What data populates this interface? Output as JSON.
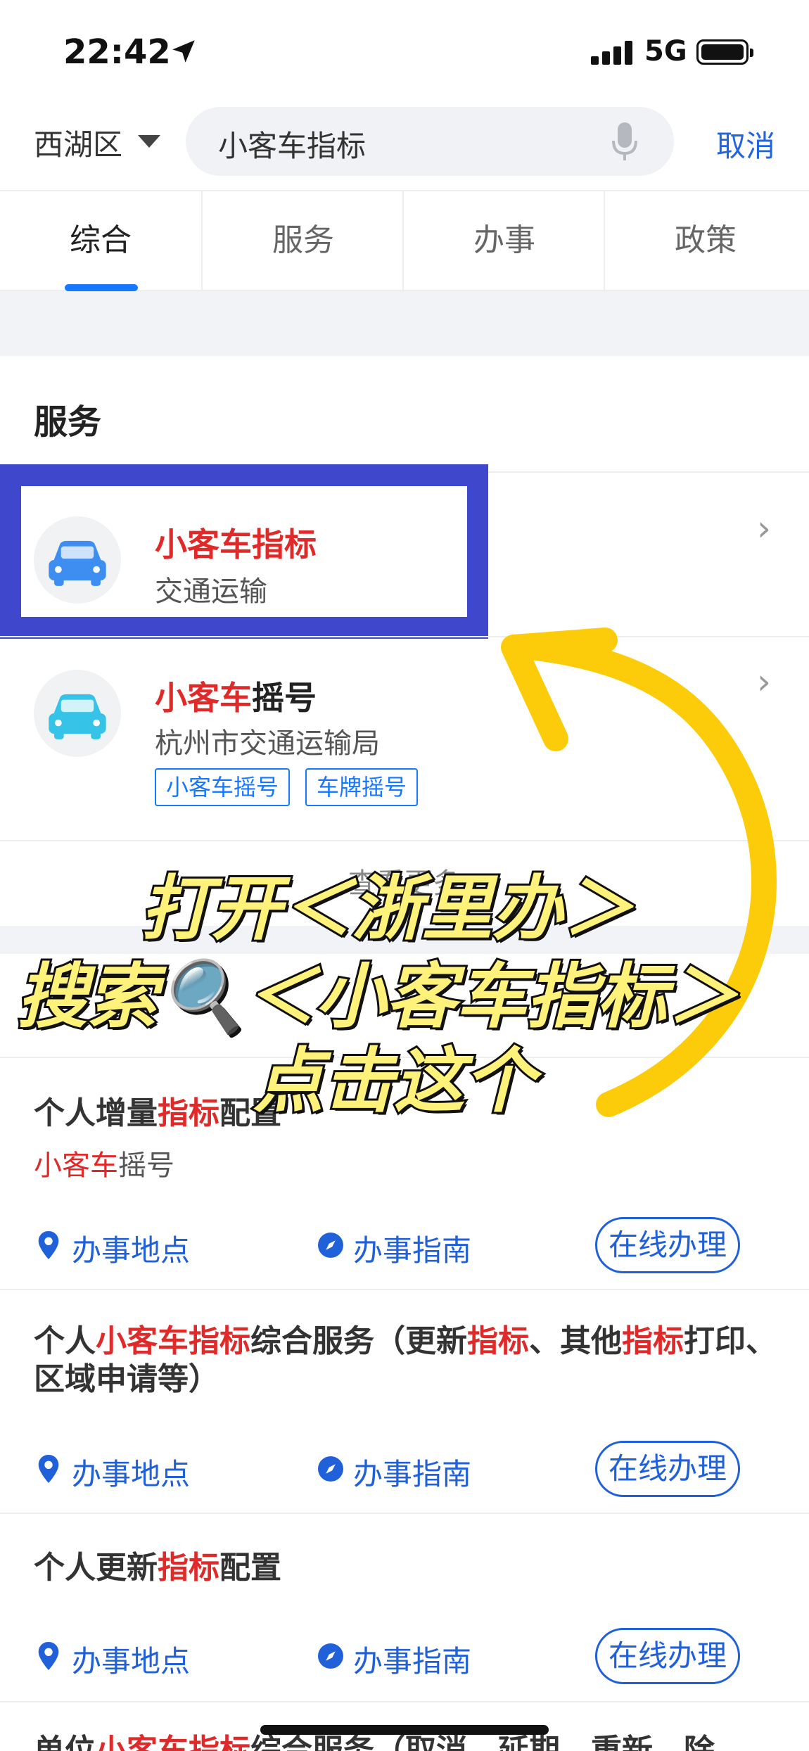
{
  "status_bar": {
    "time": "22:42",
    "network": "5G"
  },
  "search": {
    "district": "西湖区",
    "query": "小客车指标",
    "cancel": "取消"
  },
  "tabs": [
    {
      "label": "综合"
    },
    {
      "label": "服务"
    },
    {
      "label": "办事"
    },
    {
      "label": "政策"
    }
  ],
  "services": {
    "title": "服务",
    "items": [
      {
        "title_highlight": "小客车指标",
        "title_rest": "",
        "subtitle": "交通运输",
        "icon": "car-icon",
        "icon_color": "#3d8ef0",
        "tags": []
      },
      {
        "title_highlight": "小客车",
        "title_rest": "摇号",
        "subtitle": "杭州市交通运输局",
        "icon": "car-icon",
        "icon_color": "#35c3e8",
        "tags": [
          "小客车摇号",
          "车牌摇号"
        ]
      }
    ],
    "more_partial": "查看更多"
  },
  "overlay": {
    "line1": "打开＜浙里办＞",
    "line2": "搜索🔍＜小客车指标＞",
    "line3": "点击这个",
    "highlight_color": "#3f48cc",
    "arrow_color": "#fccc0a"
  },
  "matters": {
    "actions": {
      "location": "办事地点",
      "guide": "办事指南",
      "online": "在线办理"
    },
    "items": [
      {
        "t1": "个人增量",
        "t2": "指标",
        "t3": "配置",
        "sub_red": "小客车",
        "sub_rest": "摇号"
      },
      {
        "t1": "个人",
        "t2": "小客车指标",
        "t3": "综合服务（更新",
        "t4": "指标",
        "t5": "、其他",
        "t6": "指标",
        "t7": "打印、区域申请等）"
      },
      {
        "t1": "个人更新",
        "t2": "指标",
        "t3": "配置"
      },
      {
        "t1": "单位",
        "t2": "小客车指标",
        "t3": "综合服务（取消、延期、重新、除"
      }
    ]
  },
  "colors": {
    "accent": "#1677ff",
    "keyword": "#e02a2a",
    "link": "#2060d8"
  }
}
